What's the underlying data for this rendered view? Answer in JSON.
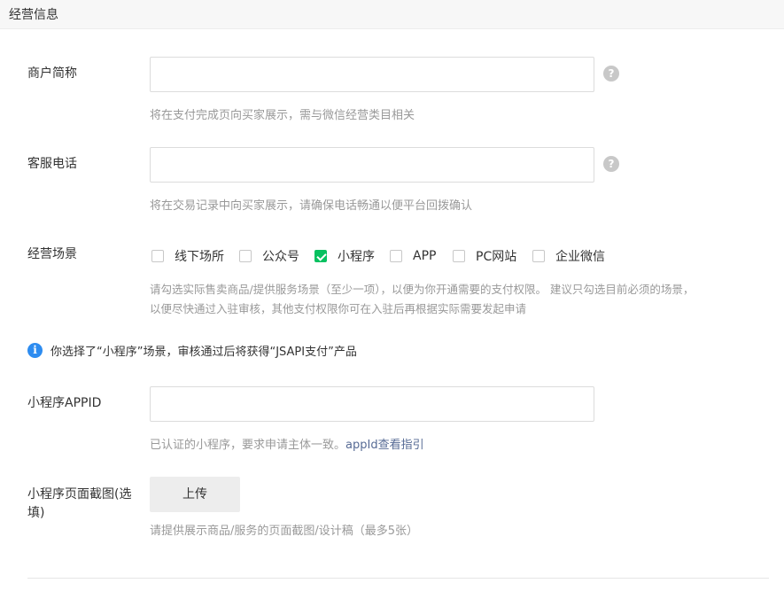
{
  "section": {
    "title": "经营信息"
  },
  "merchant_short_name": {
    "label": "商户简称",
    "value": "",
    "help_icon": "?",
    "hint": "将在支付完成页向买家展示，需与微信经营类目相关"
  },
  "service_phone": {
    "label": "客服电话",
    "value": "",
    "help_icon": "?",
    "hint": "将在交易记录中向买家展示，请确保电话畅通以便平台回拨确认"
  },
  "business_scene": {
    "label": "经营场景",
    "options": [
      {
        "label": "线下场所",
        "checked": false
      },
      {
        "label": "公众号",
        "checked": false
      },
      {
        "label": "小程序",
        "checked": true
      },
      {
        "label": "APP",
        "checked": false
      },
      {
        "label": "PC网站",
        "checked": false
      },
      {
        "label": "企业微信",
        "checked": false
      }
    ],
    "hint_line1": "请勾选实际售卖商品/提供服务场景（至少一项），以便为你开通需要的支付权限。 建议只勾选目前必须的场景，",
    "hint_line2": "以便尽快通过入驻审核，其他支付权限你可在入驻后再根据实际需要发起申请"
  },
  "notice": {
    "icon": "i",
    "text": "你选择了“小程序”场景，审核通过后将获得“JSAPI支付”产品"
  },
  "mini_program_appid": {
    "label": "小程序APPID",
    "value": "",
    "hint_text": "已认证的小程序，要求申请主体一致。",
    "hint_link": "appId查看指引"
  },
  "screenshot": {
    "label_line1": "小程序页面截图(选",
    "label_line2": "填)",
    "button_label": "上传",
    "hint": "请提供展示商品/服务的页面截图/设计稿（最多5张）"
  },
  "colors": {
    "checkbox_checked": "#07c160",
    "info_icon": "#2d8cf0",
    "link": "#576b95"
  }
}
